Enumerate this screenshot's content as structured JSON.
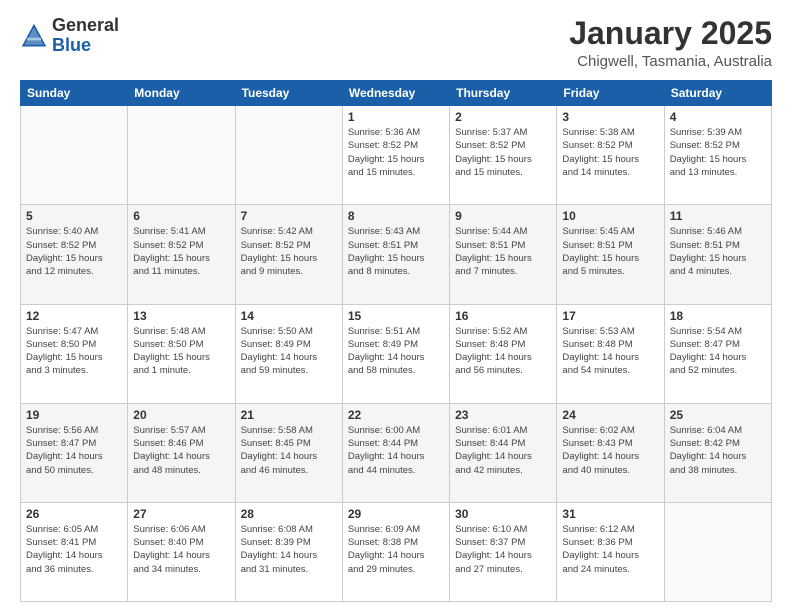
{
  "header": {
    "logo": {
      "general": "General",
      "blue": "Blue"
    },
    "title": "January 2025",
    "subtitle": "Chigwell, Tasmania, Australia"
  },
  "weekdays": [
    "Sunday",
    "Monday",
    "Tuesday",
    "Wednesday",
    "Thursday",
    "Friday",
    "Saturday"
  ],
  "weeks": [
    [
      {
        "day": "",
        "info": ""
      },
      {
        "day": "",
        "info": ""
      },
      {
        "day": "",
        "info": ""
      },
      {
        "day": "1",
        "info": "Sunrise: 5:36 AM\nSunset: 8:52 PM\nDaylight: 15 hours\nand 15 minutes."
      },
      {
        "day": "2",
        "info": "Sunrise: 5:37 AM\nSunset: 8:52 PM\nDaylight: 15 hours\nand 15 minutes."
      },
      {
        "day": "3",
        "info": "Sunrise: 5:38 AM\nSunset: 8:52 PM\nDaylight: 15 hours\nand 14 minutes."
      },
      {
        "day": "4",
        "info": "Sunrise: 5:39 AM\nSunset: 8:52 PM\nDaylight: 15 hours\nand 13 minutes."
      }
    ],
    [
      {
        "day": "5",
        "info": "Sunrise: 5:40 AM\nSunset: 8:52 PM\nDaylight: 15 hours\nand 12 minutes."
      },
      {
        "day": "6",
        "info": "Sunrise: 5:41 AM\nSunset: 8:52 PM\nDaylight: 15 hours\nand 11 minutes."
      },
      {
        "day": "7",
        "info": "Sunrise: 5:42 AM\nSunset: 8:52 PM\nDaylight: 15 hours\nand 9 minutes."
      },
      {
        "day": "8",
        "info": "Sunrise: 5:43 AM\nSunset: 8:51 PM\nDaylight: 15 hours\nand 8 minutes."
      },
      {
        "day": "9",
        "info": "Sunrise: 5:44 AM\nSunset: 8:51 PM\nDaylight: 15 hours\nand 7 minutes."
      },
      {
        "day": "10",
        "info": "Sunrise: 5:45 AM\nSunset: 8:51 PM\nDaylight: 15 hours\nand 5 minutes."
      },
      {
        "day": "11",
        "info": "Sunrise: 5:46 AM\nSunset: 8:51 PM\nDaylight: 15 hours\nand 4 minutes."
      }
    ],
    [
      {
        "day": "12",
        "info": "Sunrise: 5:47 AM\nSunset: 8:50 PM\nDaylight: 15 hours\nand 3 minutes."
      },
      {
        "day": "13",
        "info": "Sunrise: 5:48 AM\nSunset: 8:50 PM\nDaylight: 15 hours\nand 1 minute."
      },
      {
        "day": "14",
        "info": "Sunrise: 5:50 AM\nSunset: 8:49 PM\nDaylight: 14 hours\nand 59 minutes."
      },
      {
        "day": "15",
        "info": "Sunrise: 5:51 AM\nSunset: 8:49 PM\nDaylight: 14 hours\nand 58 minutes."
      },
      {
        "day": "16",
        "info": "Sunrise: 5:52 AM\nSunset: 8:48 PM\nDaylight: 14 hours\nand 56 minutes."
      },
      {
        "day": "17",
        "info": "Sunrise: 5:53 AM\nSunset: 8:48 PM\nDaylight: 14 hours\nand 54 minutes."
      },
      {
        "day": "18",
        "info": "Sunrise: 5:54 AM\nSunset: 8:47 PM\nDaylight: 14 hours\nand 52 minutes."
      }
    ],
    [
      {
        "day": "19",
        "info": "Sunrise: 5:56 AM\nSunset: 8:47 PM\nDaylight: 14 hours\nand 50 minutes."
      },
      {
        "day": "20",
        "info": "Sunrise: 5:57 AM\nSunset: 8:46 PM\nDaylight: 14 hours\nand 48 minutes."
      },
      {
        "day": "21",
        "info": "Sunrise: 5:58 AM\nSunset: 8:45 PM\nDaylight: 14 hours\nand 46 minutes."
      },
      {
        "day": "22",
        "info": "Sunrise: 6:00 AM\nSunset: 8:44 PM\nDaylight: 14 hours\nand 44 minutes."
      },
      {
        "day": "23",
        "info": "Sunrise: 6:01 AM\nSunset: 8:44 PM\nDaylight: 14 hours\nand 42 minutes."
      },
      {
        "day": "24",
        "info": "Sunrise: 6:02 AM\nSunset: 8:43 PM\nDaylight: 14 hours\nand 40 minutes."
      },
      {
        "day": "25",
        "info": "Sunrise: 6:04 AM\nSunset: 8:42 PM\nDaylight: 14 hours\nand 38 minutes."
      }
    ],
    [
      {
        "day": "26",
        "info": "Sunrise: 6:05 AM\nSunset: 8:41 PM\nDaylight: 14 hours\nand 36 minutes."
      },
      {
        "day": "27",
        "info": "Sunrise: 6:06 AM\nSunset: 8:40 PM\nDaylight: 14 hours\nand 34 minutes."
      },
      {
        "day": "28",
        "info": "Sunrise: 6:08 AM\nSunset: 8:39 PM\nDaylight: 14 hours\nand 31 minutes."
      },
      {
        "day": "29",
        "info": "Sunrise: 6:09 AM\nSunset: 8:38 PM\nDaylight: 14 hours\nand 29 minutes."
      },
      {
        "day": "30",
        "info": "Sunrise: 6:10 AM\nSunset: 8:37 PM\nDaylight: 14 hours\nand 27 minutes."
      },
      {
        "day": "31",
        "info": "Sunrise: 6:12 AM\nSunset: 8:36 PM\nDaylight: 14 hours\nand 24 minutes."
      },
      {
        "day": "",
        "info": ""
      }
    ]
  ]
}
